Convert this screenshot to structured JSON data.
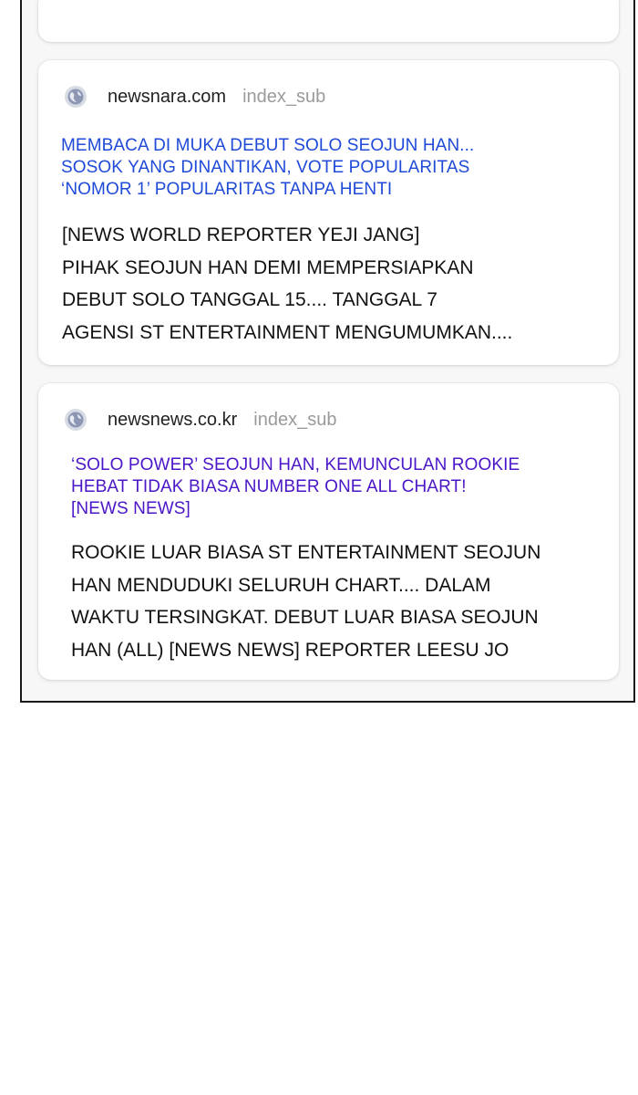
{
  "results": [
    {
      "domain": "newsnara.com",
      "section": "index_sub",
      "icon": "globe-icon",
      "headline_lines": [
        "MEMBACA DI MUKA DEBUT SOLO SEOJUN HAN...",
        "SOSOK YANG DINANTIKAN, VOTE POPULARITAS",
        "‘NOMOR 1’ POPULARITAS TANPA HENTI"
      ],
      "snippet_lines": [
        "[NEWS WORLD REPORTER YEJI JANG]",
        "PIHAK SEOJUN HAN DEMI MEMPERSIAPKAN",
        "DEBUT SOLO TANGGAL 15.... TANGGAL 7",
        "AGENSI ST ENTERTAINMENT MENGUMUMKAN...."
      ],
      "headline_color": "#1f4ad8"
    },
    {
      "domain": "newsnews.co.kr",
      "section": "index_sub",
      "icon": "globe-icon",
      "headline_lines": [
        "‘SOLO POWER’ SEOJUN HAN, KEMUNCULAN ROOKIE",
        "HEBAT TIDAK BIASA NUMBER ONE ALL CHART!",
        "[NEWS NEWS]"
      ],
      "snippet_lines": [
        "ROOKIE LUAR BIASA ST ENTERTAINMENT SEOJUN",
        "HAN MENDUDUKI SELURUH CHART.... DALAM",
        "WAKTU TERSINGKAT. DEBUT LUAR BIASA SEOJUN",
        "HAN (ALL) [NEWS NEWS] REPORTER LEESU JO"
      ],
      "headline_color": "#4a16c8"
    }
  ]
}
